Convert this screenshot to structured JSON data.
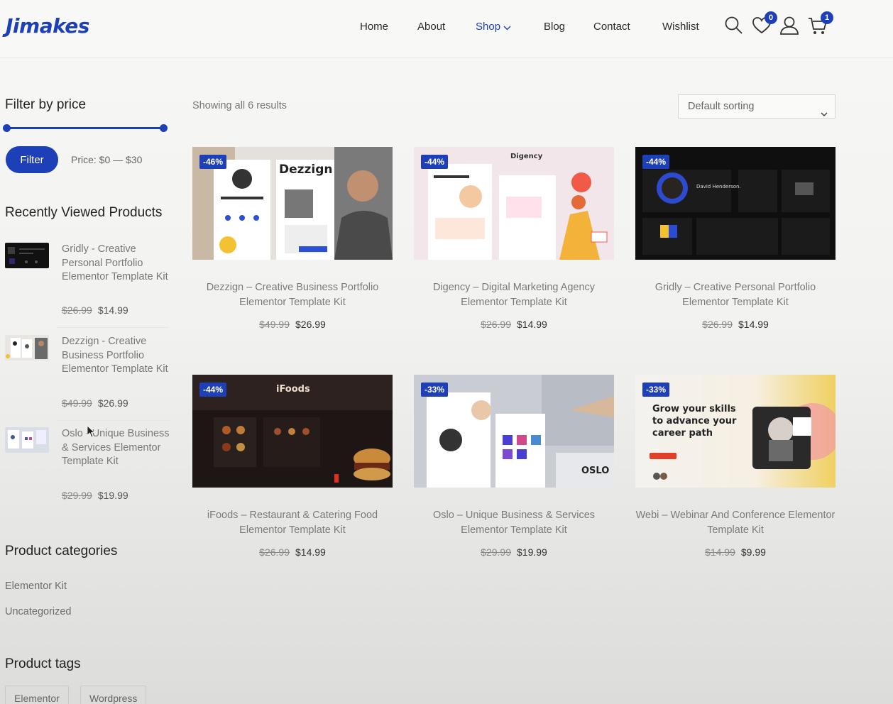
{
  "brand": {
    "logo": "Jimakes",
    "accent": "#1d3fb8"
  },
  "nav": {
    "items": [
      "Home",
      "About",
      "Shop",
      "Blog",
      "Contact",
      "Wishlist"
    ],
    "active": "Shop",
    "wishlist_count": "0",
    "cart_count": "1",
    "icons": [
      "search-icon",
      "heart-icon",
      "user-icon",
      "cart-icon"
    ]
  },
  "sidebar": {
    "filter_title": "Filter by price",
    "filter_button": "Filter",
    "price_range": "Price: $0 — $30",
    "recent_title": "Recently Viewed Products",
    "recent": [
      {
        "name": "Gridly - Creative Personal Portfolio Elementor Template Kit",
        "old": "$26.99",
        "price": "$14.99"
      },
      {
        "name": "Dezzign - Creative Business Portfolio Elementor Template Kit",
        "old": "$49.99",
        "price": "$26.99"
      },
      {
        "name": "Oslo - Unique Business & Services Elementor Template Kit",
        "old": "$29.99",
        "price": "$19.99"
      }
    ],
    "categories_title": "Product categories",
    "categories": [
      "Elementor Kit",
      "Uncategorized"
    ],
    "tags_title": "Product tags",
    "tags": [
      "Elementor",
      "Wordpress"
    ]
  },
  "shop": {
    "result_count": "Showing all 6 results",
    "sorting": "Default sorting",
    "products": [
      {
        "title": "Dezzign – Creative Business Portfolio Elementor Template Kit",
        "sale": "-46%",
        "old": "$49.99",
        "price": "$26.99",
        "img_text": "Dezzign"
      },
      {
        "title": "Digency – Digital Marketing Agency Elementor Template Kit",
        "sale": "-44%",
        "old": "$26.99",
        "price": "$14.99",
        "img_text": "Digency"
      },
      {
        "title": "Gridly – Creative Personal Portfolio Elementor Template Kit",
        "sale": "-44%",
        "old": "$26.99",
        "price": "$14.99",
        "img_text": "David Henderson."
      },
      {
        "title": "iFoods – Restaurant & Catering Food Elementor Template Kit",
        "sale": "-44%",
        "old": "$26.99",
        "price": "$14.99",
        "img_text": "iFoods"
      },
      {
        "title": "Oslo – Unique Business & Services Elementor Template Kit",
        "sale": "-33%",
        "old": "$29.99",
        "price": "$19.99",
        "img_text": "OSLO"
      },
      {
        "title": "Webi – Webinar And Conference Elementor Template Kit",
        "sale": "-33%",
        "old": "$14.99",
        "price": "$9.99",
        "img_text": "Grow your skills to advance your career path"
      }
    ]
  }
}
